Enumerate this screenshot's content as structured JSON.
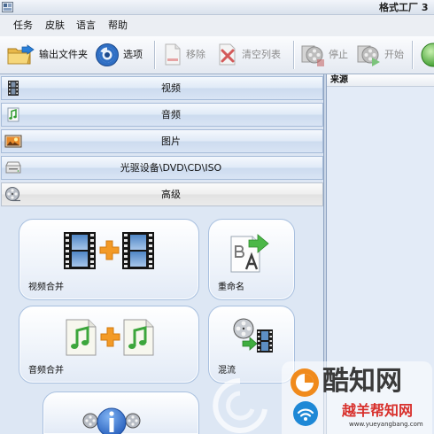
{
  "window": {
    "title": "格式工厂 3"
  },
  "menu": [
    {
      "label": "任务"
    },
    {
      "label": "皮肤"
    },
    {
      "label": "语言"
    },
    {
      "label": "帮助"
    }
  ],
  "toolbar": {
    "output_folder": {
      "label": "输出文件夹",
      "icon": "folder-arrow-icon",
      "enabled": true
    },
    "options": {
      "label": "选项",
      "icon": "options-gear-icon",
      "enabled": true
    },
    "remove": {
      "label": "移除",
      "icon": "remove-document-icon",
      "enabled": false
    },
    "clear_list": {
      "label": "清空列表",
      "icon": "clear-list-icon",
      "enabled": false
    },
    "stop": {
      "label": "停止",
      "icon": "stop-icon",
      "enabled": false
    },
    "start": {
      "label": "开始",
      "icon": "start-icon",
      "enabled": false
    },
    "overflow_icon": "green-globe-icon"
  },
  "categories": [
    {
      "label": "视频",
      "icon": "film-strip-icon"
    },
    {
      "label": "音频",
      "icon": "music-note-icon"
    },
    {
      "label": "图片",
      "icon": "picture-icon"
    },
    {
      "label": "光驱设备\\DVD\\CD\\ISO",
      "icon": "disc-drive-icon"
    },
    {
      "label": "高级",
      "icon": "film-reel-icon",
      "selected": true
    }
  ],
  "tools": [
    {
      "label": "视频合并",
      "icon": "video-merge-icon"
    },
    {
      "label": "重命名",
      "icon": "rename-icon"
    },
    {
      "label": "音频合并",
      "icon": "audio-merge-icon"
    },
    {
      "label": "混流",
      "icon": "mux-icon"
    },
    {
      "icon": "media-info-icon"
    }
  ],
  "file_list": {
    "columns": [
      "来源"
    ]
  },
  "watermark": {
    "brand": "酷知网",
    "site": "越羊帮知网",
    "url": "www.yueyangbang.com"
  },
  "colors": {
    "panel_bg": "#dde6f3",
    "category_border": "#a6bbd8",
    "accent_blue": "#2f6fc4",
    "plus_orange": "#f39a26",
    "note_green": "#3ca63c",
    "disabled_text": "#8c8c8c"
  }
}
